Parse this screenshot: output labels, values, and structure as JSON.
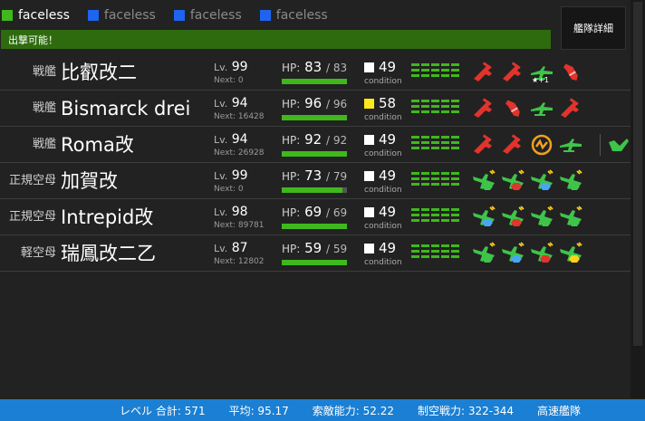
{
  "tabs": [
    {
      "label": "faceless",
      "color": "#3fb81c",
      "active": true
    },
    {
      "label": "faceless",
      "color": "#1e64f0",
      "active": false
    },
    {
      "label": "faceless",
      "color": "#1e64f0",
      "active": false
    },
    {
      "label": "faceless",
      "color": "#1e64f0",
      "active": false
    }
  ],
  "detail_button": "艦隊詳細",
  "sortie_status": "出撃可能！",
  "ships": [
    {
      "type": "戦艦",
      "name": "比叡改二",
      "lv": "99",
      "next": "0",
      "hp": "83",
      "hp_max": "83",
      "hp_ratio": 1.0,
      "cond": "49",
      "cond_color": "#ffffff",
      "equips": [
        "main-gun-red-icon",
        "main-gun-red-icon",
        "seaplane-green-icon",
        "shell-red-icon"
      ],
      "equip_marks": [
        "",
        "",
        "★+1",
        ""
      ],
      "ex": ""
    },
    {
      "type": "戦艦",
      "name": "Bismarck drei",
      "lv": "94",
      "next": "16428",
      "hp": "96",
      "hp_max": "96",
      "hp_ratio": 1.0,
      "cond": "58",
      "cond_color": "#ffe81c",
      "equips": [
        "main-gun-red-icon",
        "shell-red-icon",
        "seaplane-green-icon",
        "main-gun-red-icon"
      ],
      "equip_marks": [
        "",
        "",
        "",
        ""
      ],
      "ex": ""
    },
    {
      "type": "戦艦",
      "name": "Roma改",
      "lv": "94",
      "next": "26928",
      "hp": "92",
      "hp_max": "92",
      "hp_ratio": 1.0,
      "cond": "49",
      "cond_color": "#ffffff",
      "equips": [
        "main-gun-red-icon",
        "main-gun-red-icon",
        "radar-orange-icon",
        "seaplane-green-icon"
      ],
      "equip_marks": [
        "",
        "",
        "",
        ""
      ],
      "ex": "aa-gun-green-icon"
    },
    {
      "type": "正規空母",
      "name": "加賀改",
      "lv": "99",
      "next": "0",
      "hp": "73",
      "hp_max": "79",
      "hp_ratio": 0.924,
      "cond": "49",
      "cond_color": "#ffffff",
      "equips": [
        "fighter-green-icon",
        "bomber-red-icon",
        "torpedo-bomber-blue-icon",
        "fighter-green-icon"
      ],
      "equip_marks": [
        "",
        "",
        "",
        ""
      ],
      "ex": ""
    },
    {
      "type": "正規空母",
      "name": "Intrepid改",
      "lv": "98",
      "next": "89781",
      "hp": "69",
      "hp_max": "69",
      "hp_ratio": 1.0,
      "cond": "49",
      "cond_color": "#ffffff",
      "equips": [
        "torpedo-bomber-blue-icon",
        "bomber-red-icon",
        "fighter-green-icon",
        "fighter-green-icon"
      ],
      "equip_marks": [
        "",
        "",
        "",
        ""
      ],
      "ex": ""
    },
    {
      "type": "軽空母",
      "name": "瑞鳳改二乙",
      "lv": "87",
      "next": "12802",
      "hp": "59",
      "hp_max": "59",
      "hp_ratio": 1.0,
      "cond": "49",
      "cond_color": "#ffffff",
      "equips": [
        "fighter-green-icon",
        "torpedo-bomber-blue-icon",
        "bomber-red-icon",
        "recon-yellow-icon"
      ],
      "equip_marks": [
        "",
        "",
        "",
        ""
      ],
      "ex": ""
    }
  ],
  "labels": {
    "lv": "Lv.",
    "next": "Next:",
    "hp": "HP:",
    "condition": "condition"
  },
  "footer": {
    "level_total": "レベル 合計: 571",
    "average": "平均: 95.17",
    "los": "索敵能力: 52.22",
    "air": "制空戦力: 322-344",
    "speed": "高速艦隊"
  }
}
